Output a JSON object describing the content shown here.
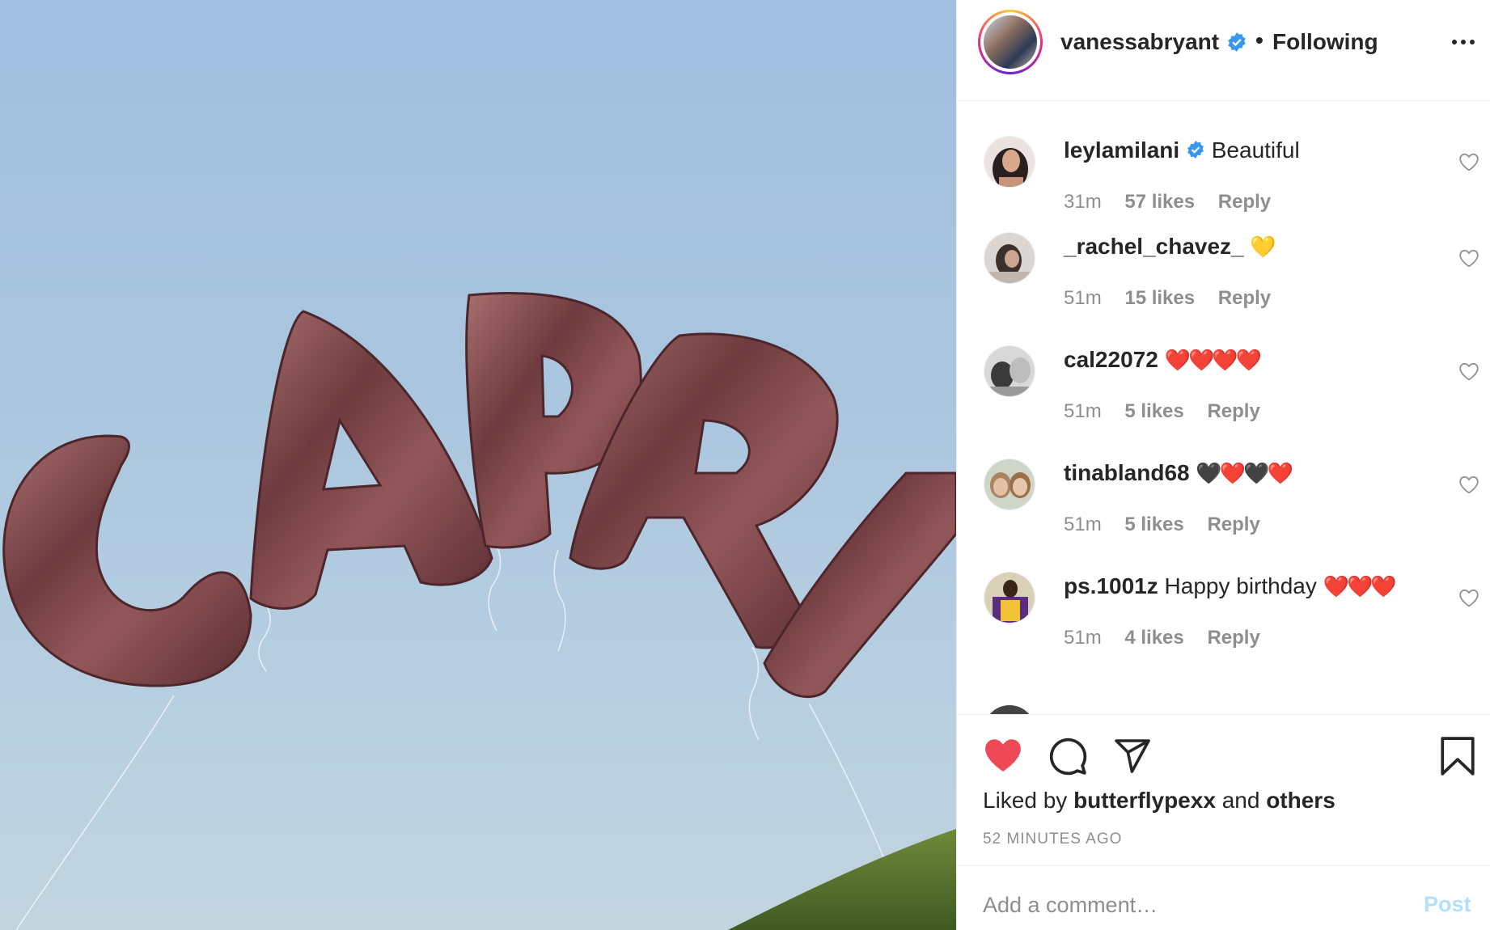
{
  "photo": {
    "balloon_text": "CAPRI",
    "balloon_color": "#8a4f4f",
    "sky_color": "#a6c2df"
  },
  "header": {
    "username": "vanessabryant",
    "verified": true,
    "separator": "•",
    "follow_status": "Following",
    "more_icon": "more-horizontal-icon"
  },
  "comments": [
    {
      "username": "leylamilani",
      "verified": true,
      "text": "Beautiful",
      "emoji": "",
      "time": "31m",
      "likes": "57 likes",
      "reply": "Reply"
    },
    {
      "username": "_rachel_chavez_",
      "verified": false,
      "text": "",
      "emoji": "💛",
      "time": "51m",
      "likes": "15 likes",
      "reply": "Reply"
    },
    {
      "username": "cal22072",
      "verified": false,
      "text": "",
      "emoji": "❤️❤️❤️❤️",
      "time": "51m",
      "likes": "5 likes",
      "reply": "Reply"
    },
    {
      "username": "tinabland68",
      "verified": false,
      "text": "",
      "emoji": "🖤❤️🖤❤️",
      "time": "51m",
      "likes": "5 likes",
      "reply": "Reply"
    },
    {
      "username": "ps.1001z",
      "verified": false,
      "text": "Happy birthday",
      "emoji": "❤️❤️❤️",
      "time": "51m",
      "likes": "4 likes",
      "reply": "Reply"
    }
  ],
  "actions": {
    "like_icon": "heart-filled-icon",
    "comment_icon": "comment-icon",
    "share_icon": "send-icon",
    "save_icon": "bookmark-icon",
    "like_color": "#ed4956"
  },
  "likes_line": {
    "prefix": "Liked by",
    "user": "butterflypexx",
    "conj": "and",
    "others": "others"
  },
  "timestamp": "52 MINUTES AGO",
  "add_comment": {
    "placeholder": "Add a comment…",
    "post_label": "Post"
  },
  "colors": {
    "verified_blue": "#3897f0",
    "muted_text": "#8e8e8e",
    "post_disabled": "#b2dffc"
  }
}
